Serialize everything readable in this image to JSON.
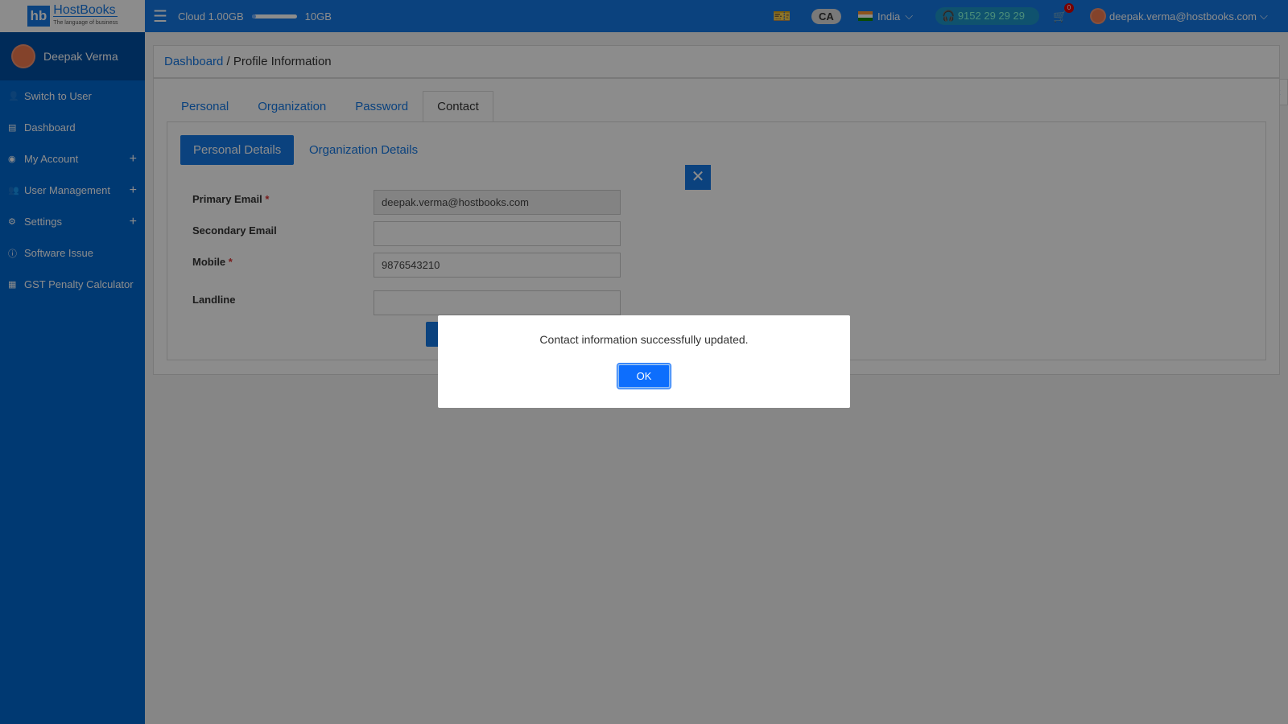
{
  "logo": {
    "mark": "hb",
    "name": "HostBooks",
    "tagline": "The language of business"
  },
  "topbar": {
    "cloud_label": "Cloud 1.00GB",
    "storage_max": "10GB",
    "storage_used_fraction": 0.1,
    "ca_label": "CA",
    "country": "India",
    "phone": "9152 29 29 29",
    "cart_count": "0",
    "user_email": "deepak.verma@hostbooks.com"
  },
  "sidebar": {
    "user_name": "Deepak Verma",
    "items": [
      {
        "label": "Switch to User",
        "icon": "user-icon",
        "expandable": false
      },
      {
        "label": "Dashboard",
        "icon": "dashboard-icon",
        "expandable": false
      },
      {
        "label": "My Account",
        "icon": "account-circle-icon",
        "expandable": true
      },
      {
        "label": "User Management",
        "icon": "users-icon",
        "expandable": true
      },
      {
        "label": "Settings",
        "icon": "gear-icon",
        "expandable": true
      },
      {
        "label": "Software Issue",
        "icon": "info-icon",
        "expandable": false
      },
      {
        "label": "GST Penalty Calculator",
        "icon": "calculator-icon",
        "expandable": false
      }
    ]
  },
  "breadcrumb": {
    "root": "Dashboard",
    "sep": " / ",
    "current": "Profile Information"
  },
  "tabs": [
    "Personal",
    "Organization",
    "Password",
    "Contact"
  ],
  "active_tab": "Contact",
  "subtabs": {
    "personal": "Personal Details",
    "organization": "Organization Details"
  },
  "form": {
    "primary_email": {
      "label": "Primary Email",
      "value": "deepak.verma@hostbooks.com"
    },
    "secondary_email": {
      "label": "Secondary Email",
      "value": ""
    },
    "mobile": {
      "label": "Mobile",
      "value": "9876543210"
    },
    "landline": {
      "label": "Landline",
      "value": ""
    },
    "required_mark": "*"
  },
  "modal": {
    "message": "Contact information successfully updated.",
    "ok_label": "OK"
  },
  "colors": {
    "primary": "#1479e6",
    "sidebar": "#0068d0"
  }
}
